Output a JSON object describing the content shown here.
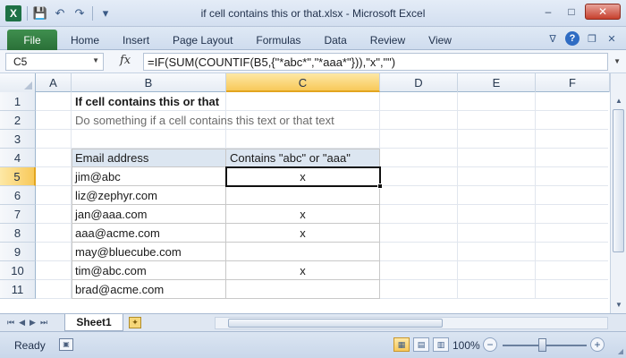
{
  "window": {
    "title": "if cell contains this or that.xlsx - Microsoft Excel",
    "minimize": "–",
    "maximize": "□",
    "close": "✕"
  },
  "qat": {
    "app_icon": "excel-icon",
    "app_letter": "X",
    "save": "💾",
    "undo": "↶",
    "redo": "↷",
    "customize": "▾"
  },
  "ribbon": {
    "file_tab": "File",
    "tabs": [
      "Home",
      "Insert",
      "Page Layout",
      "Formulas",
      "Data",
      "Review",
      "View"
    ],
    "minimize_ribbon": "∇",
    "help": "?",
    "restore": "❐",
    "close_workbook": "✕"
  },
  "formula_bar": {
    "name_box": "C5",
    "name_box_arrow": "▼",
    "fx_label": "fx",
    "formula": "=IF(SUM(COUNTIF(B5,{\"*abc*\",\"*aaa*\"})),\"x\",\"\")",
    "expand": "▼"
  },
  "grid": {
    "columns": [
      "A",
      "B",
      "C",
      "D",
      "E",
      "F"
    ],
    "selected_column": "C",
    "rows": [
      "1",
      "2",
      "3",
      "4",
      "5",
      "6",
      "7",
      "8",
      "9",
      "10",
      "11"
    ],
    "selected_row": "5",
    "title": "If cell contains this or that",
    "subtitle": "Do something if a cell contains this text or that text",
    "table_headers": [
      "Email address",
      "Contains \"abc\" or \"aaa\""
    ],
    "table_rows": [
      [
        "jim@abc",
        "x"
      ],
      [
        "liz@zephyr.com",
        ""
      ],
      [
        "jan@aaa.com",
        "x"
      ],
      [
        "aaa@acme.com",
        "x"
      ],
      [
        "may@bluecube.com",
        ""
      ],
      [
        "tim@abc.com",
        "x"
      ],
      [
        "brad@acme.com",
        ""
      ]
    ]
  },
  "sheets": {
    "nav_first": "⏮",
    "nav_prev": "◀",
    "nav_next": "▶",
    "nav_last": "⏭",
    "active_sheet": "Sheet1",
    "new_sheet_icon": "✦"
  },
  "status": {
    "ready": "Ready",
    "zoom": "100%",
    "zoom_fraction": 0.5,
    "zoom_minus": "−",
    "zoom_plus": "+",
    "view_normal": "▦",
    "view_layout": "▤",
    "view_break": "▥"
  },
  "colors": {
    "excel_green": "#1e7145",
    "selection_accent": "#f8c95a",
    "table_header_fill": "#dce6f1"
  }
}
